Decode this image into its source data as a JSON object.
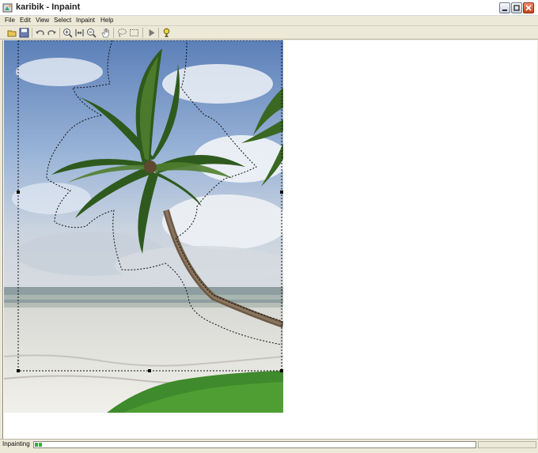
{
  "window": {
    "title": "karibik - Inpaint",
    "icon": "app-icon",
    "controls": [
      "minimize-icon",
      "maximize-icon",
      "close-icon"
    ]
  },
  "menu": {
    "file": "File",
    "edit": "Edit",
    "view": "View",
    "select": "Select",
    "inpaint": "Inpaint",
    "help": "Help"
  },
  "toolbar": {
    "icons": [
      "open-icon",
      "save-icon",
      "undo-icon",
      "redo-icon",
      "zoom-in-icon",
      "actual-size-icon",
      "zoom-out-icon",
      "hand-icon",
      "lasso-icon",
      "rect-select-icon",
      "run-icon",
      "help-icon"
    ]
  },
  "status": {
    "text": "Inpainting",
    "progress_fraction": 0.02
  },
  "colors": {
    "chrome": "#ece9d8",
    "progress": "#35b035",
    "close_button": "#c2401e"
  }
}
